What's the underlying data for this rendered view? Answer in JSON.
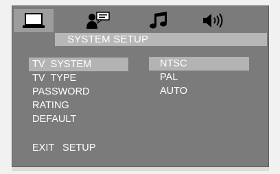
{
  "tabs": [
    {
      "icon": "monitor-icon",
      "active": true
    },
    {
      "icon": "person-speech-icon",
      "active": false
    },
    {
      "icon": "music-note-icon",
      "active": false
    },
    {
      "icon": "speaker-icon",
      "active": false
    }
  ],
  "header": {
    "title": "SYSTEM SETUP"
  },
  "menu": {
    "items": [
      {
        "label": "TV  SYSTEM",
        "selected": true
      },
      {
        "label": "TV  TYPE",
        "selected": false
      },
      {
        "label": "PASSWORD",
        "selected": false
      },
      {
        "label": "RATING",
        "selected": false
      },
      {
        "label": "DEFAULT",
        "selected": false
      }
    ],
    "exit_label": "EXIT   SETUP"
  },
  "options": {
    "items": [
      {
        "label": "NTSC",
        "selected": true
      },
      {
        "label": "PAL",
        "selected": false
      },
      {
        "label": "AUTO",
        "selected": false
      }
    ]
  },
  "colors": {
    "panel": "#7b7b7b",
    "highlight": "#b3b3b3",
    "text": "#ffffff"
  }
}
